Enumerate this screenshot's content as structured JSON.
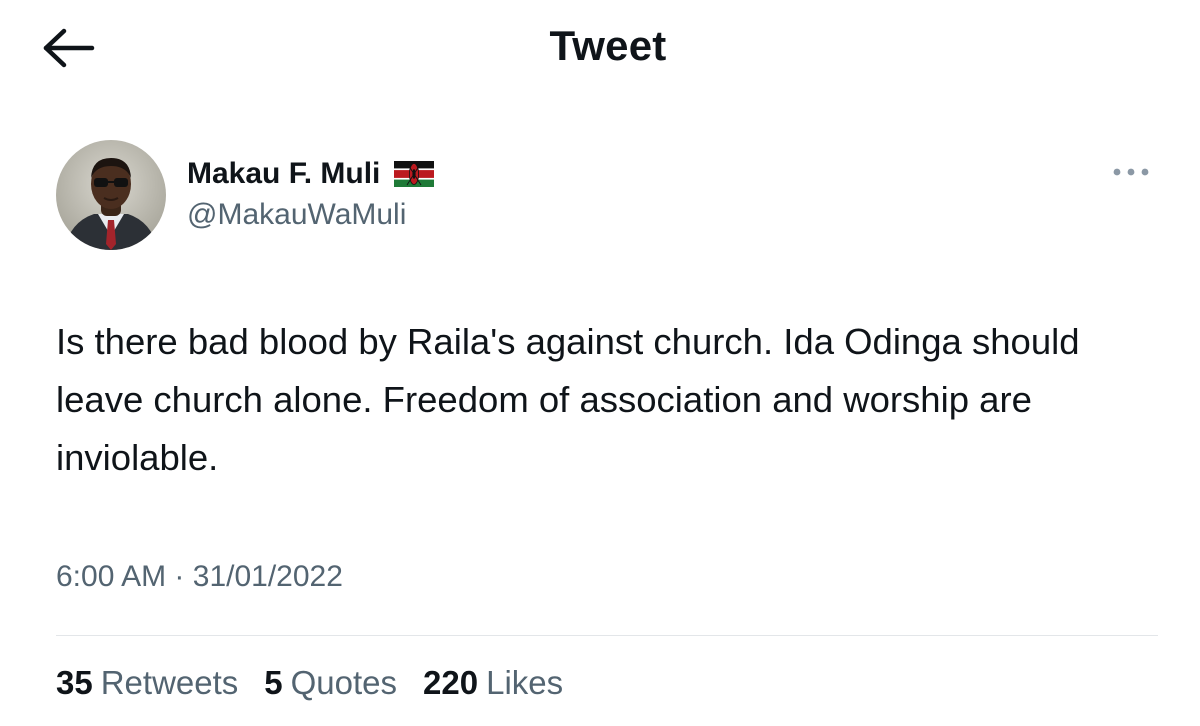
{
  "header": {
    "back_icon": "arrow-left-icon",
    "title": "Tweet"
  },
  "author": {
    "display_name": "Makau F. Muli",
    "flag_icon": "kenya-flag-icon",
    "handle": "@MakauWaMuli",
    "more_icon": "more-horizontal-icon"
  },
  "tweet": {
    "text": "Is there bad blood by Raila's against church. Ida Odinga should leave church alone. Freedom of association and worship are inviolable.",
    "time": "6:00 AM",
    "separator": "·",
    "date": "31/01/2022"
  },
  "stats": {
    "retweets_count": "35",
    "retweets_label": "Retweets",
    "quotes_count": "5",
    "quotes_label": "Quotes",
    "likes_count": "220",
    "likes_label": "Likes"
  },
  "colors": {
    "text_primary": "#0f1419",
    "text_secondary": "#536471",
    "divider": "#e3e6e9",
    "more_dots": "#8b98a5"
  }
}
